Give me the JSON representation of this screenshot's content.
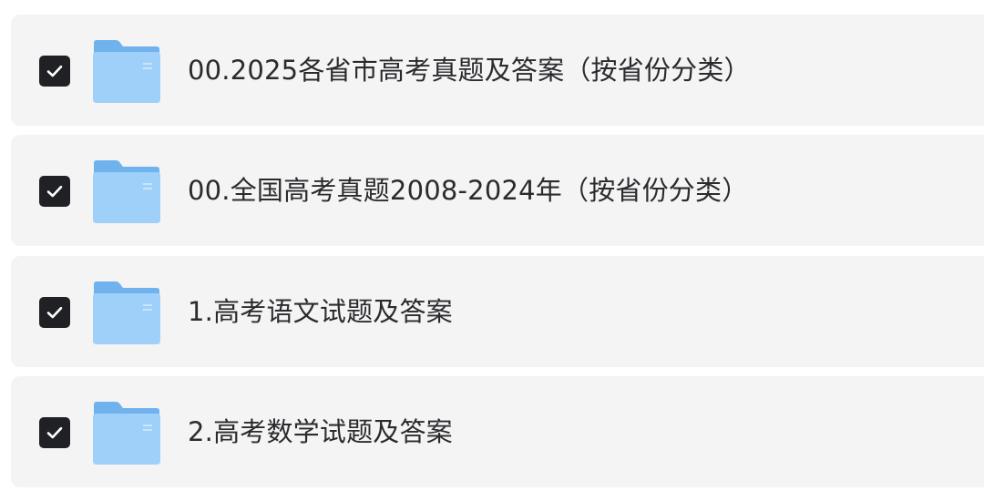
{
  "file_list": {
    "items": [
      {
        "name": "00.2025各省市高考真题及答案（按省份分类）",
        "checked": true,
        "icon": "folder-icon"
      },
      {
        "name": "00.全国高考真题2008-2024年（按省份分类）",
        "checked": true,
        "icon": "folder-icon"
      },
      {
        "name": "1.高考语文试题及答案",
        "checked": true,
        "icon": "folder-icon"
      },
      {
        "name": "2.高考数学试题及答案",
        "checked": true,
        "icon": "folder-icon"
      }
    ]
  },
  "colors": {
    "row_background": "#f4f4f5",
    "checkbox_fill": "#202124",
    "checkmark": "#ffffff",
    "folder_back": "#6fb2ee",
    "folder_front": "#9fd0fa",
    "text": "#2b2b2e"
  }
}
